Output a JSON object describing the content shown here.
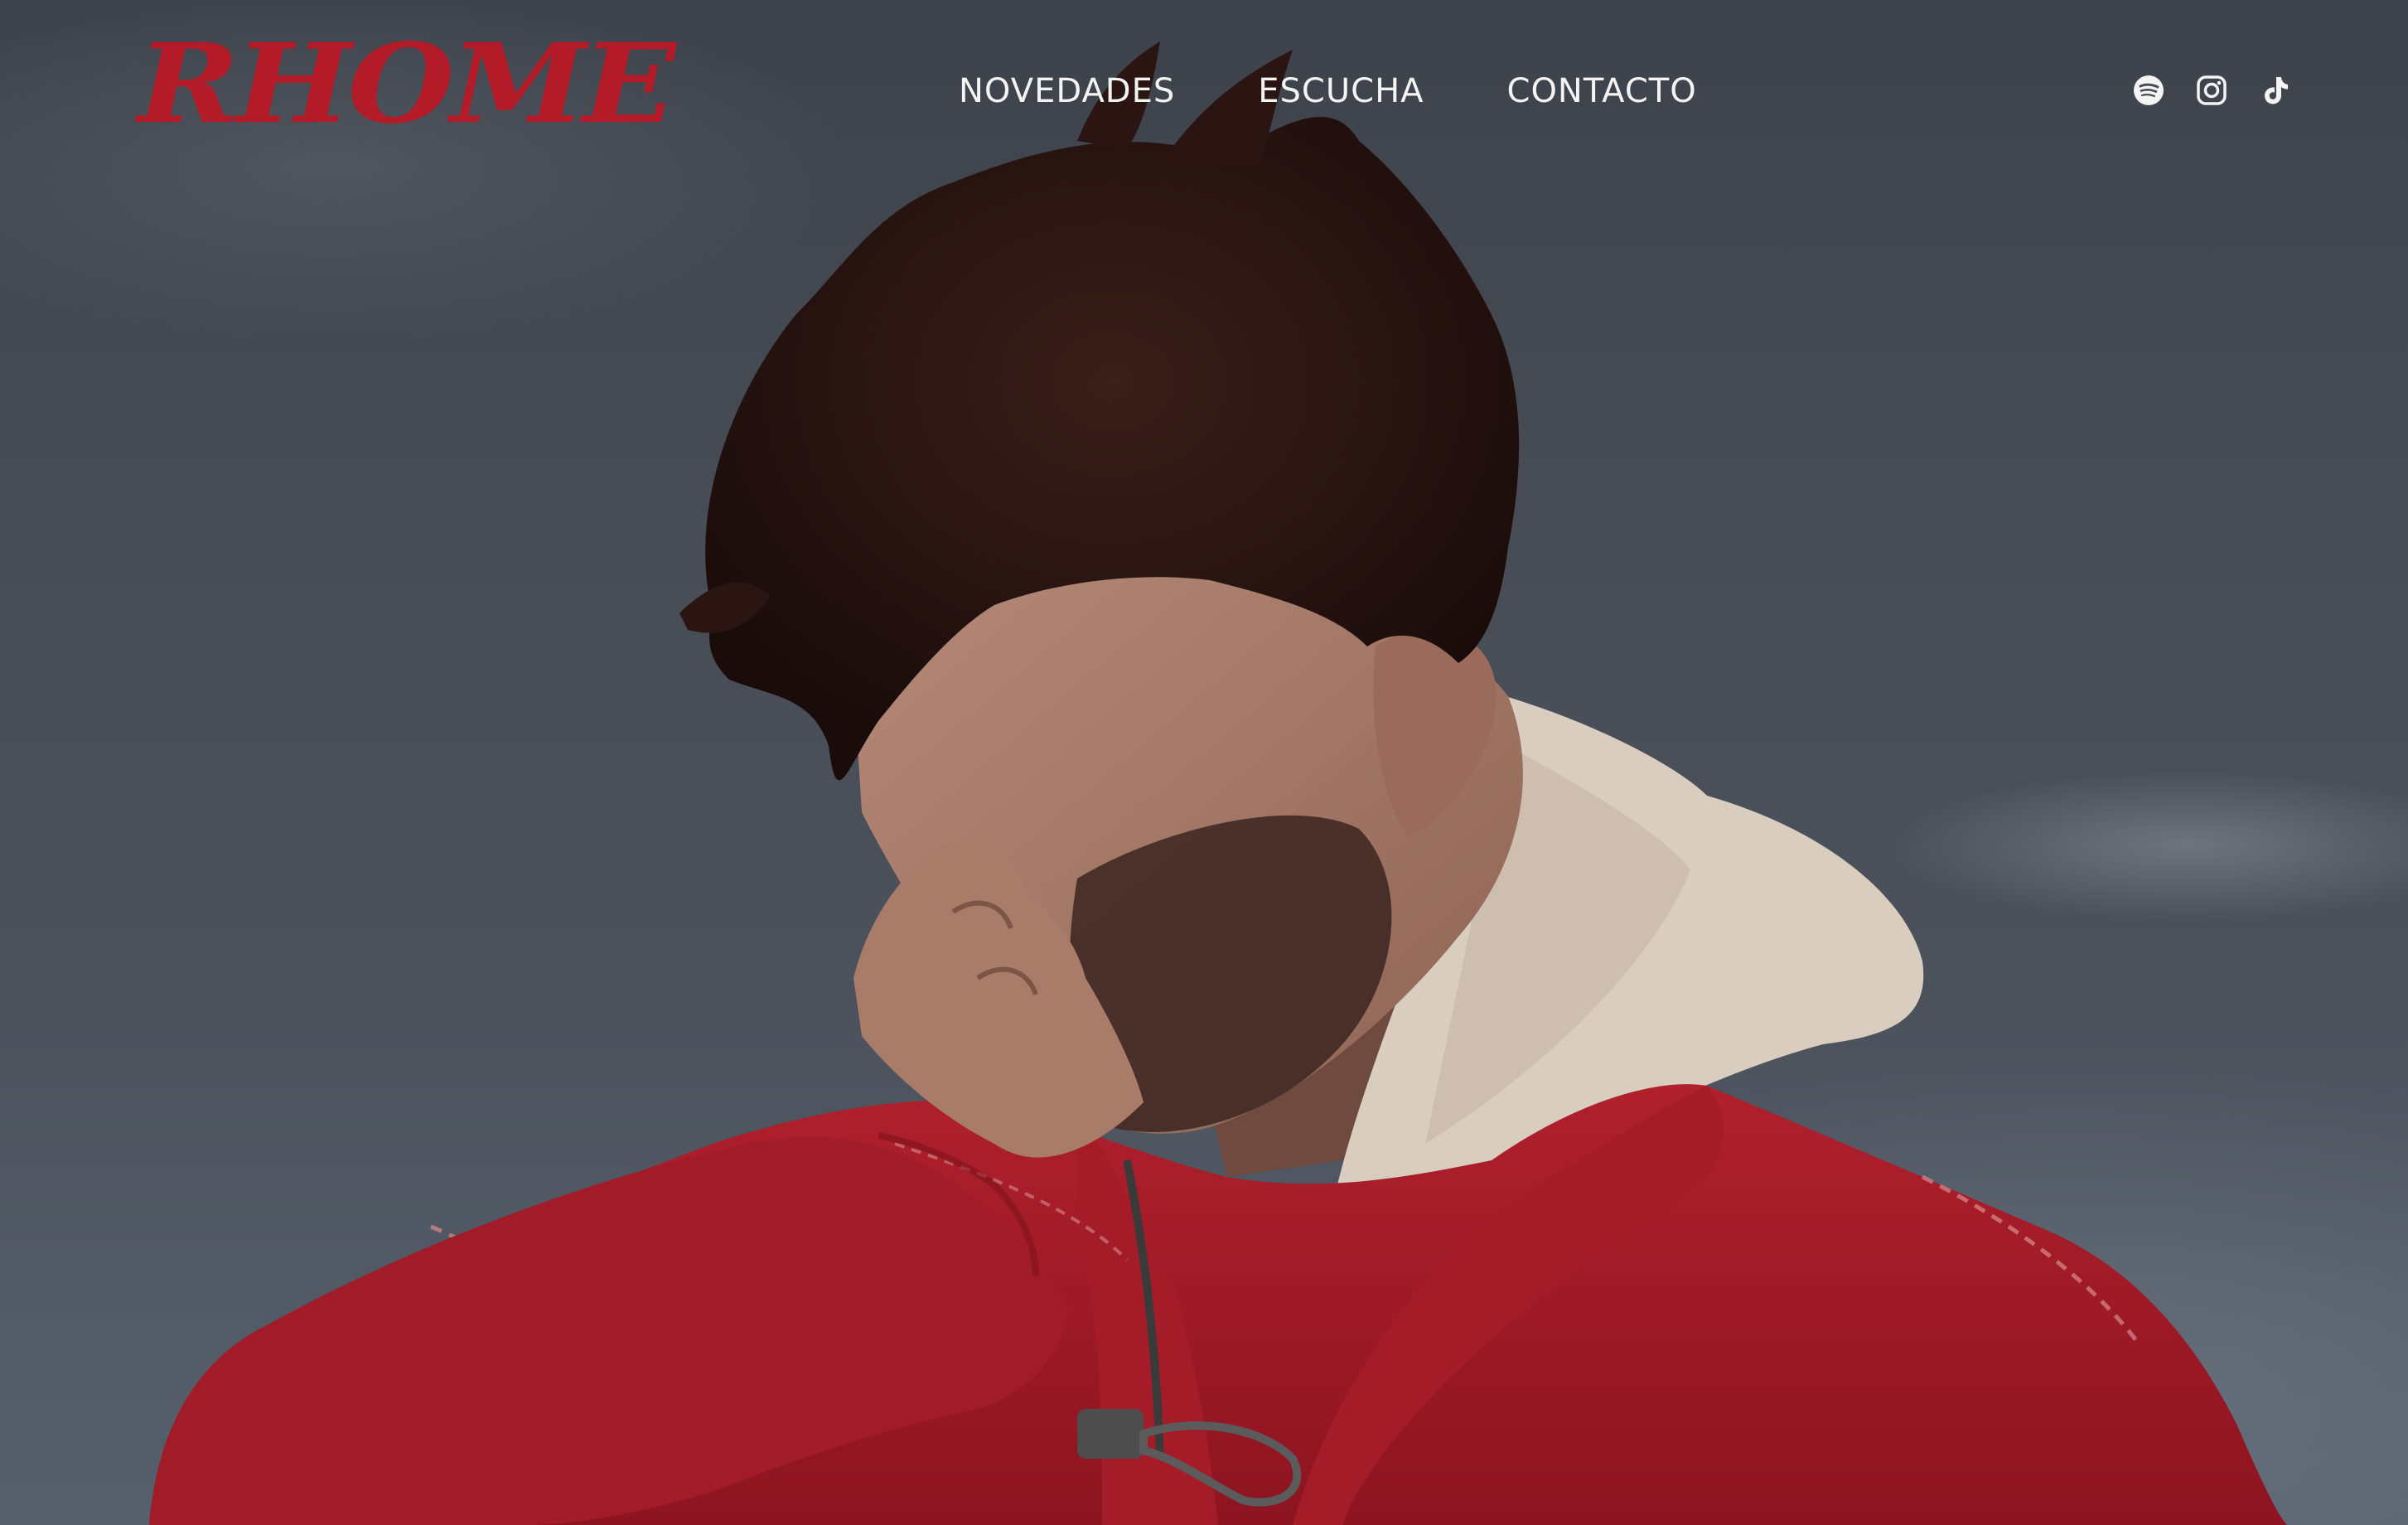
{
  "header": {
    "logo_text": "RHOME",
    "nav": [
      {
        "label": "NOVEDADES"
      },
      {
        "label": "ESCUCHA"
      },
      {
        "label": "CONTACTO"
      }
    ],
    "social": [
      {
        "icon": "spotify-icon"
      },
      {
        "icon": "instagram-icon"
      },
      {
        "icon": "tiktok-icon"
      }
    ]
  },
  "colors": {
    "brand": "#b31b28",
    "nav_text": "#f4f4f4",
    "sky": "#474c55",
    "jacket": "#9e1826"
  }
}
